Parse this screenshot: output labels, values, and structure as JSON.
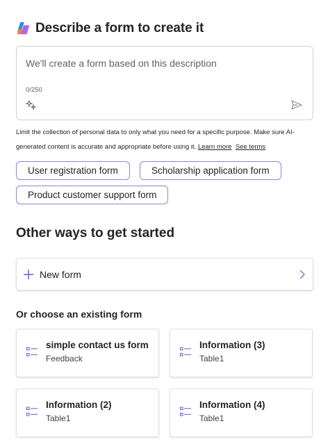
{
  "header": {
    "title": "Describe a form to create it"
  },
  "description": {
    "placeholder": "We'll create a form based on this description",
    "counter": "0/250"
  },
  "disclaimer": {
    "text": "Limit the collection of personal data to only what you need for a specific purpose. Make sure AI-generated content is accurate and appropriate before using it.",
    "learn_more": "Learn more",
    "see_terms": "See terms"
  },
  "suggestions": [
    "User registration form",
    "Scholarship application form",
    "Product customer support form"
  ],
  "other_ways": {
    "title": "Other ways to get started",
    "new_form_label": "New form"
  },
  "existing": {
    "title": "Or choose an existing form",
    "forms": [
      {
        "title": "simple contact us form",
        "subtitle": "Feedback"
      },
      {
        "title": "Information (3)",
        "subtitle": "Table1"
      },
      {
        "title": "Information (2)",
        "subtitle": "Table1"
      },
      {
        "title": "Information (4)",
        "subtitle": "Table1"
      }
    ]
  },
  "colors": {
    "accent": "#5b5fc7",
    "chip_border": "#8f84d8",
    "border": "#d1d1d1"
  }
}
